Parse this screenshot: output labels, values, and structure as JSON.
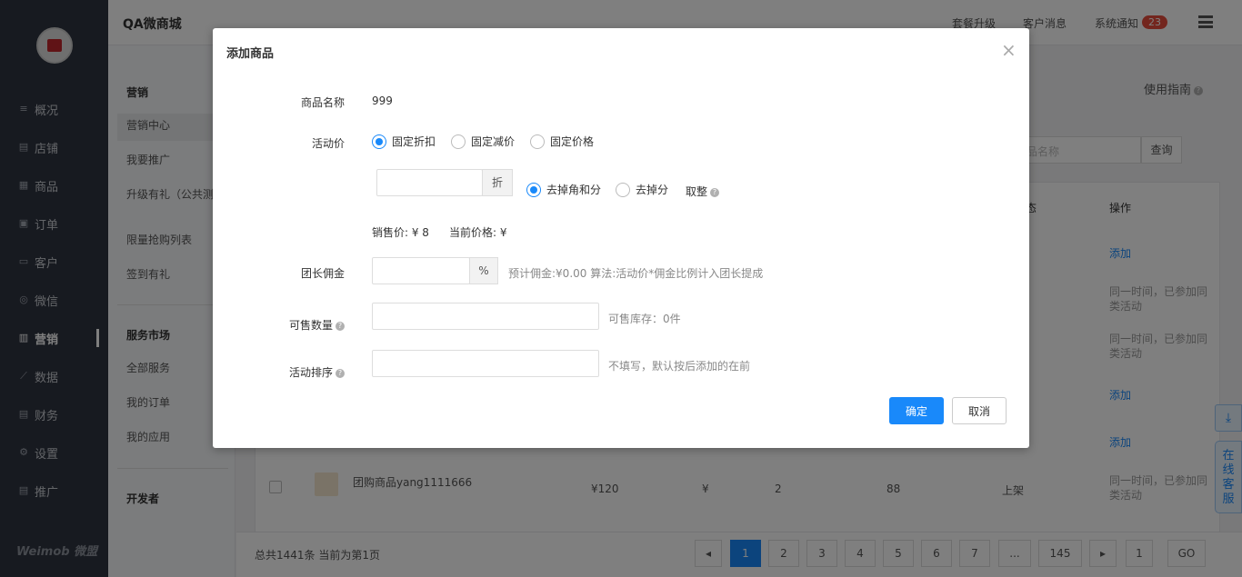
{
  "topbar": {
    "shop_name": "QA微商城",
    "links": [
      "套餐升级",
      "客户消息",
      "系统通知"
    ],
    "notice_count": "23"
  },
  "nav": {
    "items": [
      "概况",
      "店铺",
      "商品",
      "订单",
      "客户",
      "微信",
      "营销",
      "数据",
      "财务",
      "设置",
      "推广"
    ],
    "active": "营销",
    "brand": "Weimob 微盟"
  },
  "subnav": {
    "section1_title": "营销",
    "section1_items": [
      "营销中心",
      "我要推广",
      "升级有礼（公共测）",
      "限量抢购列表",
      "签到有礼"
    ],
    "section2_title": "服务市场",
    "section2_items": [
      "全部服务",
      "我的订单",
      "我的应用"
    ],
    "section3_title": "开发者"
  },
  "main": {
    "guide": "使用指南",
    "search_placeholder": "品名称",
    "search_button": "查询",
    "col_status": "态",
    "col_action": "操作",
    "action_add": "添加",
    "same_activity": "同一时间，已参加同类活动",
    "row": {
      "name": "团购商品yang1111666",
      "price": "¥120",
      "sale_price": "¥",
      "qty": "2",
      "stock": "88",
      "status": "上架"
    }
  },
  "pagination": {
    "total": "总共1441条 当前为第1页",
    "pages": [
      "1",
      "2",
      "3",
      "4",
      "5",
      "6",
      "7",
      "...",
      "145"
    ],
    "current": "1",
    "goto_value": "1",
    "go": "GO"
  },
  "float": {
    "customer_service": "在线客服"
  },
  "modal": {
    "title": "添加商品",
    "name_label": "商品名称",
    "name_value": "999",
    "price_label": "活动价",
    "price_types": [
      "固定折扣",
      "固定减价",
      "固定价格"
    ],
    "selected_price_type": "固定折扣",
    "discount_unit": "折",
    "rounding": [
      "去掉角和分",
      "去掉分"
    ],
    "selected_rounding": "去掉角和分",
    "round_label": "取整",
    "sale_price": "销售价: ¥ 8",
    "current_price": "当前价格: ¥",
    "commission_label": "团长佣金",
    "commission_unit": "%",
    "commission_hint": "预计佣金:¥0.00 算法:活动价*佣金比例计入团长提成",
    "qty_label": "可售数量",
    "qty_hint": "可售库存：0件",
    "sort_label": "活动排序",
    "sort_hint": "不填写，默认按后添加的在前",
    "ok": "确定",
    "cancel": "取消"
  }
}
